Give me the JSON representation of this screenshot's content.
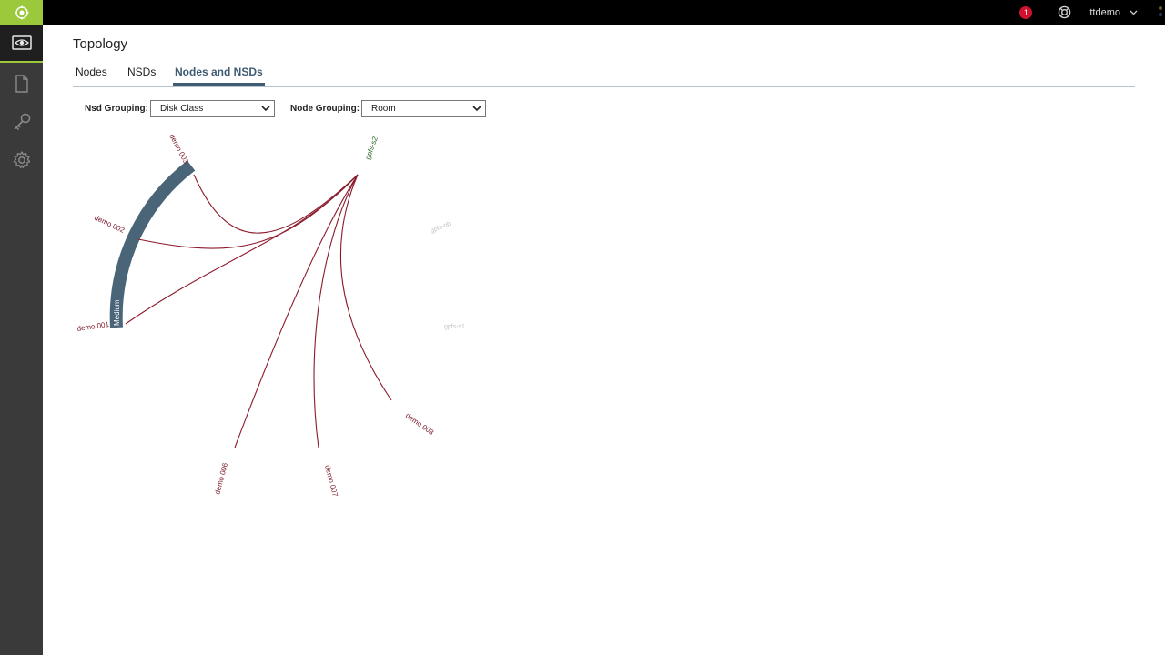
{
  "header": {
    "alert_count": "1",
    "user": "ttdemo"
  },
  "page": {
    "title": "Topology",
    "tabs": [
      {
        "label": "Nodes"
      },
      {
        "label": "NSDs"
      },
      {
        "label": "Nodes and NSDs",
        "active": true
      }
    ]
  },
  "controls": {
    "nsd_grouping": {
      "label": "Nsd Grouping:",
      "value": "Disk Class"
    },
    "node_grouping": {
      "label": "Node Grouping:",
      "value": "Room"
    }
  },
  "diagram": {
    "group_label": "Medium",
    "nodes": {
      "demo001": "demo 001",
      "demo002": "demo 002",
      "demo003": "demo 003",
      "demo006": "demo 006",
      "demo007": "demo 007",
      "demo008": "demo 008",
      "gpfs_s2": "gpfs-s2",
      "gpfs_s1": "gpfs-s1",
      "gpfs_nb": "gpfs-nb"
    }
  },
  "colors": {
    "accent": "#9cc93c",
    "arc": "#4a6478",
    "link": "#8b1a2b",
    "alert": "#d0122e"
  }
}
